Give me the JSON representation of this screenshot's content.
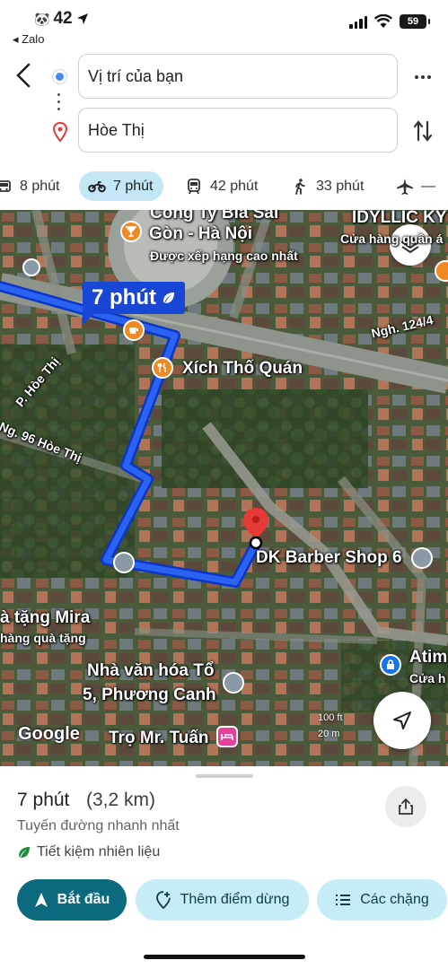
{
  "status_bar": {
    "time": "42",
    "back_app": "◂ Zalo",
    "battery": "59"
  },
  "route_inputs": {
    "origin": "Vị trí của bạn",
    "destination": "Hòe Thị"
  },
  "travel_modes": [
    {
      "mode": "car",
      "label": "8 phút",
      "selected": false
    },
    {
      "mode": "motorbike",
      "label": "7 phút",
      "selected": true
    },
    {
      "mode": "transit",
      "label": "42 phút",
      "selected": false
    },
    {
      "mode": "walk",
      "label": "33 phút",
      "selected": false
    },
    {
      "mode": "flight",
      "label": "—",
      "selected": false
    }
  ],
  "map": {
    "time_callout": "7 phút",
    "labels": {
      "brewery_line1": "Công Ty Bia Sài",
      "brewery_line2": "Gòn - Hà Nội",
      "brewery_sub": "Được xếp hạng cao nhất",
      "idyllic": "IDYLLIC KY",
      "idyllic_sub": "Cửa hàng quần á",
      "street_124": "Ngh. 124/4",
      "street_hoe_thi": "P. Hòe Thị",
      "alley_96": "Ng. 96 Hòe Thị",
      "xich_tho": "Xích Thố Quán",
      "barber": "DK Barber Shop 6",
      "gift_line1": "à tặng Mira",
      "gift_line2": "hàng quà tặng",
      "culture_line1": "Nhà văn hóa Tổ",
      "culture_line2": "5, Phương Canh",
      "atim": "Atim",
      "atim_sub": "Cửa h",
      "tro": "Trọ Mr. Tuấn"
    },
    "scale_top": "100 ft",
    "scale_bottom": "20 m",
    "logo": "Google"
  },
  "route_summary": {
    "duration": "7 phút",
    "distance": "(3,2 km)",
    "description": "Tuyến đường nhanh nhất",
    "fuel_note": "Tiết kiệm nhiên liệu"
  },
  "actions": {
    "start": "Bắt đầu",
    "add_stop": "Thêm điểm dừng",
    "steps": "Các chặng"
  },
  "colors": {
    "route": "#1a4fe0",
    "accent": "#0b6a7d",
    "chip": "#c6ecf8",
    "selected_mode": "#c3e7f7",
    "pin": "#e53935"
  }
}
